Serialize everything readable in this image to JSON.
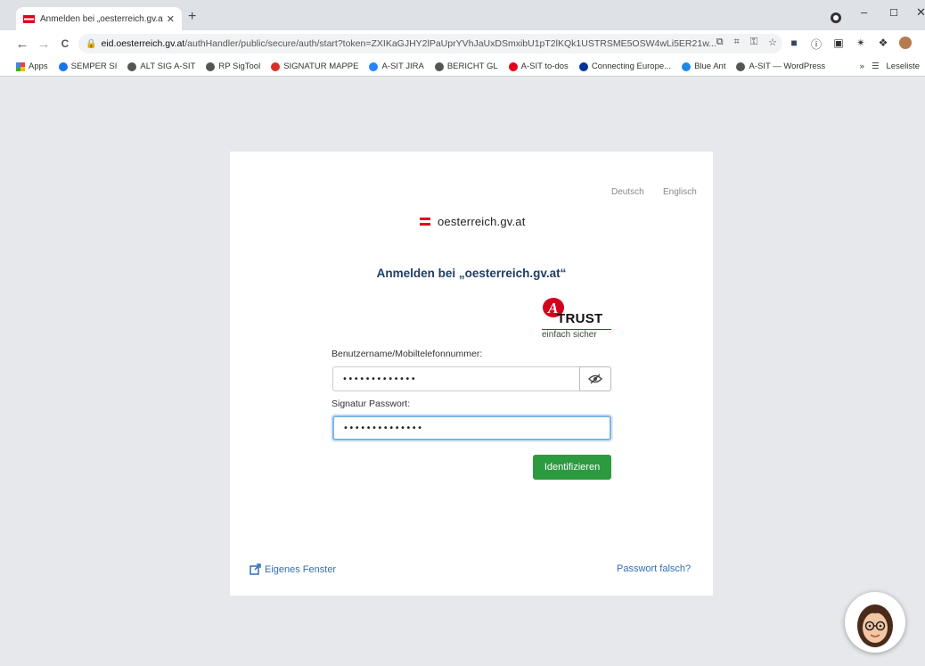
{
  "browser": {
    "tab_title": "Anmelden bei „oesterreich.gv.at“",
    "tab_close": "✕",
    "new_tab": "+",
    "window_controls": {
      "minimize": "–",
      "maximize": "☐",
      "close": "✕"
    },
    "nav": {
      "back": "←",
      "forward": "→",
      "reload": "C"
    },
    "url_host": "eid.oesterreich.gv.at",
    "url_path": "/authHandler/public/secure/auth/start?token=ZXIKaGJHY2lPaUprYVhJaUxDSmxibU1pT2lKQk1USTRSME5OSW4wLi5ER21w...",
    "omnibox_icons": [
      "install-icon",
      "qr-icon",
      "key-icon",
      "star-icon"
    ],
    "extension_icons": [
      "extension-a-icon",
      "extension-b-icon",
      "extension-c-icon",
      "extension-d-icon",
      "puzzle-icon",
      "profile-icon",
      "menu-icon"
    ],
    "bookmarks": [
      {
        "label": "Apps",
        "icon": "apps-icon",
        "color": "#4285f4"
      },
      {
        "label": "SEMPER SI",
        "icon": "semper-icon",
        "color": "#1a73e8"
      },
      {
        "label": "ALT SIG A-SIT",
        "icon": "globe-icon",
        "color": "#555555"
      },
      {
        "label": "RP SigTool",
        "icon": "globe-icon",
        "color": "#555555"
      },
      {
        "label": "SIGNATUR MAPPE",
        "icon": "signatur-icon",
        "color": "#d93025"
      },
      {
        "label": "A-SIT JIRA",
        "icon": "jira-icon",
        "color": "#2684ff"
      },
      {
        "label": "BERICHT GL",
        "icon": "globe-icon",
        "color": "#555555"
      },
      {
        "label": "A-SIT to-dos",
        "icon": "todo-icon",
        "color": "#e2001a"
      },
      {
        "label": "Connecting Europe...",
        "icon": "cef-icon",
        "color": "#003399"
      },
      {
        "label": "Blue Ant",
        "icon": "blueant-icon",
        "color": "#1e88e5"
      },
      {
        "label": "A-SIT — WordPress",
        "icon": "globe-icon",
        "color": "#555555"
      }
    ],
    "bookmarks_more": "»",
    "reading_list": "Leseliste"
  },
  "page": {
    "languages": {
      "de": "Deutsch",
      "en": "Englisch"
    },
    "brand": "oesterreich.gv.at",
    "heading": "Anmelden bei „oesterreich.gv.at“",
    "atrust": {
      "word": "TRUST",
      "slogan": "einfach sicher"
    },
    "username": {
      "label": "Benutzername/Mobiltelefonnummer:",
      "value": "•••••••••••••"
    },
    "password": {
      "label": "Signatur Passwort:",
      "value": "••••••••••••••"
    },
    "submit_label": "Identifizieren",
    "own_window_label": "Eigenes Fenster",
    "wrong_password_label": "Passwort falsch?",
    "colors": {
      "primary_text": "#1d3e66",
      "submit": "#2c9a3f",
      "link": "#2f6fb7",
      "austria_red": "#e2001a"
    }
  }
}
